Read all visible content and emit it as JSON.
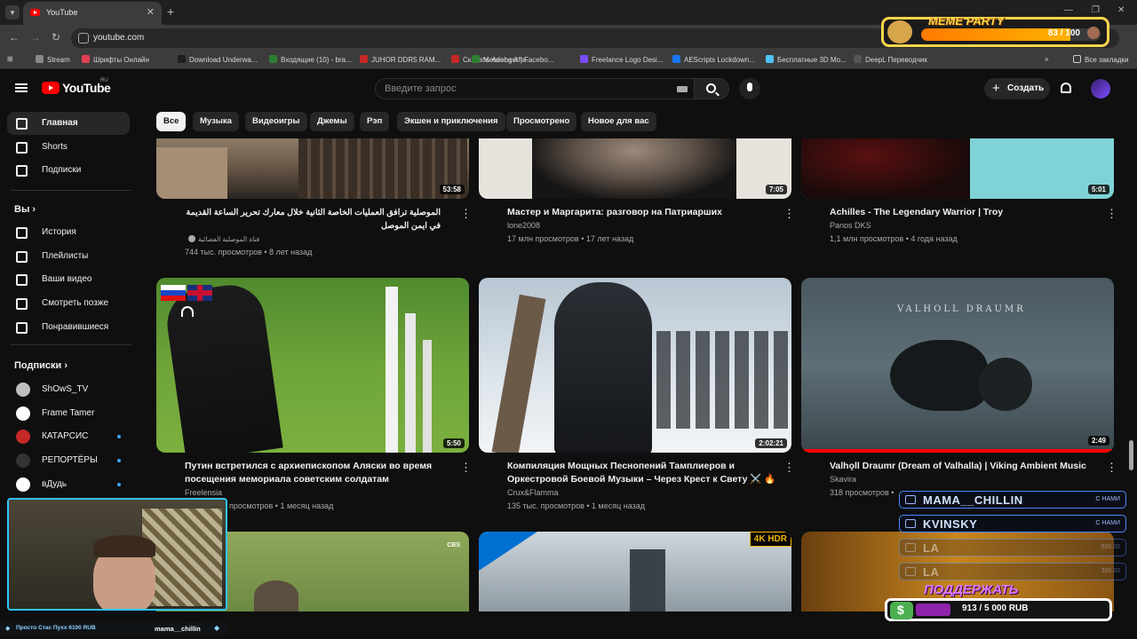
{
  "browser": {
    "tab_title": "YouTube",
    "url": "youtube.com",
    "bookmarks": [
      "Stream",
      "Шрифты Онлайн",
      "Download Underwa...",
      "Входящие (10) - bra...",
      "JUHOR DDR5 RAM...",
      "Скачать Adobe Afte...",
      "Messenger | Facebo...",
      "Freelance Logo Desi...",
      "AEScripts Lockdown...",
      "Бесплатные 3D Мо...",
      "DeepL Переводчик"
    ],
    "bookmarks_overflow": "»",
    "all_bookmarks": "Все закладки"
  },
  "header": {
    "logo_text": "YouTube",
    "logo_region": "RU",
    "search_placeholder": "Введите запрос",
    "create_label": "Создать"
  },
  "sidebar": {
    "main": [
      {
        "label": "Главная",
        "icon": "home-icon",
        "active": true
      },
      {
        "label": "Shorts",
        "icon": "shorts-icon"
      },
      {
        "label": "Подписки",
        "icon": "subscriptions-icon"
      }
    ],
    "you_heading": "Вы",
    "you": [
      {
        "label": "История",
        "icon": "history-icon"
      },
      {
        "label": "Плейлисты",
        "icon": "playlists-icon"
      },
      {
        "label": "Ваши видео",
        "icon": "your-videos-icon"
      },
      {
        "label": "Смотреть позже",
        "icon": "watch-later-icon"
      },
      {
        "label": "Понравившиеся",
        "icon": "liked-icon"
      }
    ],
    "subs_heading": "Подписки",
    "subs": [
      {
        "label": "ShOwS_TV",
        "color": "#bfbfbf",
        "dot": false
      },
      {
        "label": "Frame Tamer",
        "color": "#ffffff",
        "dot": false
      },
      {
        "label": "КАТАРСИС",
        "color": "#c62828",
        "dot": true
      },
      {
        "label": "РЕПОРТЁРЫ",
        "color": "#333333",
        "dot": true
      },
      {
        "label": "вДудь",
        "color": "#ffffff",
        "dot": true
      }
    ]
  },
  "chips": [
    "Все",
    "Музыка",
    "Видеоигры",
    "Джемы",
    "Рэп",
    "Экшен и приключения",
    "Просмотрено",
    "Новое для вас"
  ],
  "videos_row1": [
    {
      "title": "الموصلية ترافق العمليات الخاصة الثانية خلال معارك تحرير الساعة القديمة في ايمن الموصل",
      "channel": "قناة الموصلية الفضائية",
      "meta": "744 тыс. просмотров • 8 лет назад",
      "duration": "53:58"
    },
    {
      "title": "Мастер и Маргарита: разговор на Патриарших",
      "channel": "lone2008",
      "meta": "17 млн просмотров • 17 лет назад",
      "duration": "7:05"
    },
    {
      "title": "Achilles - The Legendary Warrior | Troy",
      "channel": "Panos DKS",
      "meta": "1,1 млн просмотров • 4 года назад",
      "duration": "5:01"
    }
  ],
  "videos_row2": [
    {
      "title": "Путин встретился с архиепископом Аляски во время посещения мемориала советским солдатам",
      "channel": "Freelensia",
      "meta": "просмотров • 1 месяц назад",
      "duration": "5:50"
    },
    {
      "title": "Компиляция Мощных Песнопений Тамплиеров и Оркестровой Боевой Музыки – Через Крест к Свету ⚔️ 🔥",
      "channel": "Crux&Flamma",
      "meta": "135 тыс. просмотров • 1 месяц назад",
      "duration": "2:02:21"
    },
    {
      "title": "Valhǫll Draumr (Dream of Valhalla) | Viking Ambient Music",
      "channel": "Skavira",
      "meta": "318 просмотров •",
      "duration": "2:49",
      "thumb_text": "VALHOLL DRAUMR"
    }
  ],
  "row3_badges": {
    "cbs": "CBS",
    "hdr": "4K HDR"
  },
  "overlay": {
    "meme_title": "MEME PARTY",
    "meme_count": "83 / 100",
    "meme_progress": 0.83,
    "chat": [
      {
        "name": "MAMA__CHILLIN",
        "badge": "С НАМИ"
      },
      {
        "name": "KVINSKY",
        "badge": "С НАМИ"
      },
      {
        "name": "LA",
        "badge": "900.00"
      },
      {
        "name": "LA",
        "badge": "300.00"
      }
    ],
    "donate_title": "ПОДДЕРЖАТЬ",
    "donate_amount": "913 / 5 000 RUB",
    "donate_progress": 0.18,
    "webcam_left": "Просто Стас Пухх 6100 RUB",
    "webcam_right": "mama__chillin"
  }
}
